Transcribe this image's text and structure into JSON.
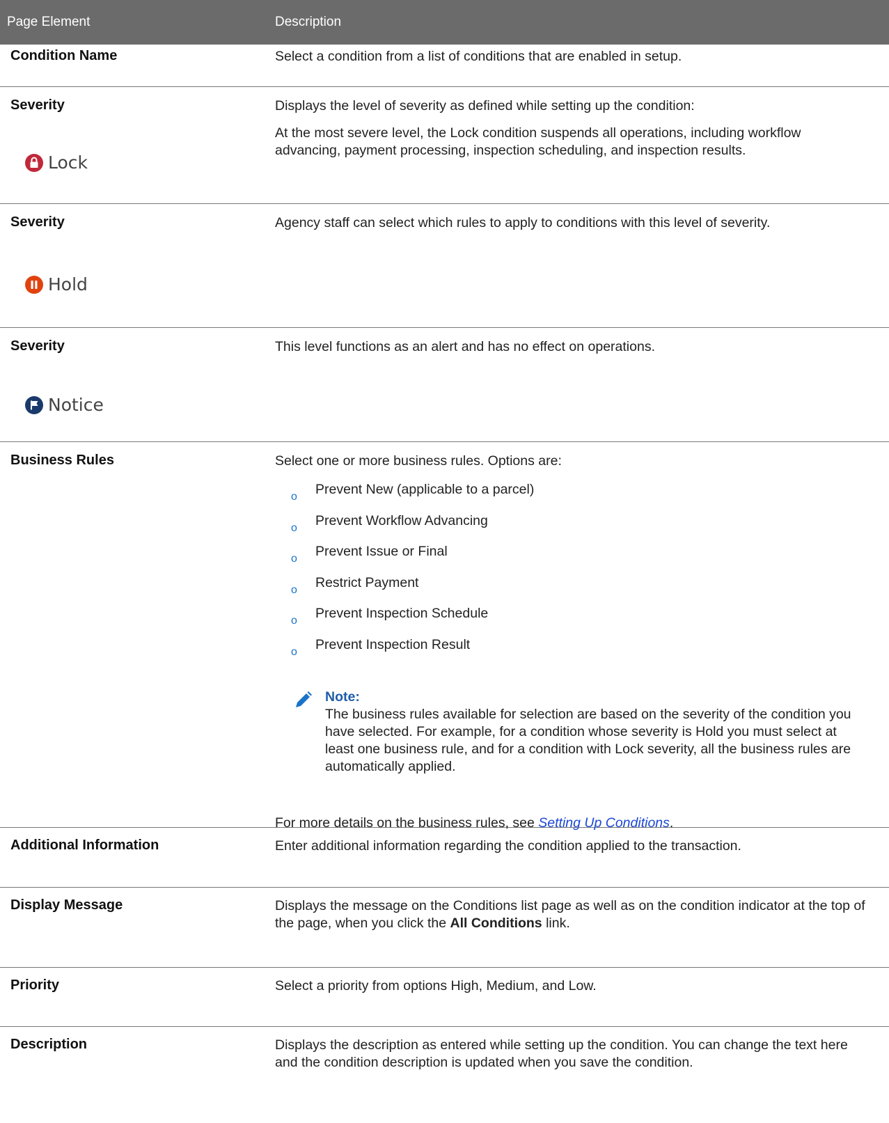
{
  "header": {
    "col1": "Page Element",
    "col2": "Description"
  },
  "rows": {
    "condition_name": {
      "element": "Condition Name",
      "desc": "Select a condition from a list of conditions that are enabled in setup."
    },
    "severity_lock": {
      "element": "Severity",
      "desc1": "Displays the level of severity as defined while setting up the condition:",
      "desc2": "At the most severe level, the Lock condition suspends all operations, including workflow advancing, payment processing, inspection scheduling, and inspection results.",
      "badge": "Lock",
      "badge_color": "#c0283a"
    },
    "severity_hold": {
      "element": "Severity",
      "desc": "Agency staff can select which rules to apply to conditions with this level of severity.",
      "badge": "Hold",
      "badge_color": "#e0430f"
    },
    "severity_notice": {
      "element": "Severity",
      "desc": "This level functions as an alert and has no effect on operations.",
      "badge": "Notice",
      "badge_color": "#1b3a6b"
    },
    "business_rules": {
      "element": "Business Rules",
      "intro": "Select one or more business rules. Options are:",
      "bullet": "o",
      "options": [
        "Prevent New (applicable to a parcel)",
        "Prevent Workflow Advancing",
        "Prevent Issue or Final",
        "Restrict Payment",
        "Prevent Inspection Schedule",
        "Prevent Inspection Result"
      ],
      "note_title": "Note:",
      "note_body": "The business rules available for selection are based on the severity of the condition you have selected. For example, for a condition whose severity is Hold you must select at least one business rule, and for a condition with Lock severity, all the business rules are automatically applied.",
      "more_prefix": "For more details on the business rules, see ",
      "more_link": "Setting Up Conditions",
      "more_suffix": "."
    },
    "additional_info": {
      "element": "Additional Information",
      "desc": "Enter additional information regarding the condition applied to the transaction."
    },
    "display_message": {
      "element": "Display Message",
      "desc_prefix": "Displays the message on the Conditions list page as well as on the condition indicator at the top of the page, when you click the ",
      "desc_bold": "All Conditions",
      "desc_suffix": " link."
    },
    "priority": {
      "element": "Priority",
      "desc": "Select a priority from options High, Medium, and Low."
    },
    "description": {
      "element": "Description",
      "desc": "Displays the description as entered while setting up the condition. You can change the text here and the condition description is updated when you save the condition."
    }
  },
  "colors": {
    "header_bg": "#6b6b6b",
    "link": "#1a47d6",
    "note_title": "#1f5ea8"
  }
}
